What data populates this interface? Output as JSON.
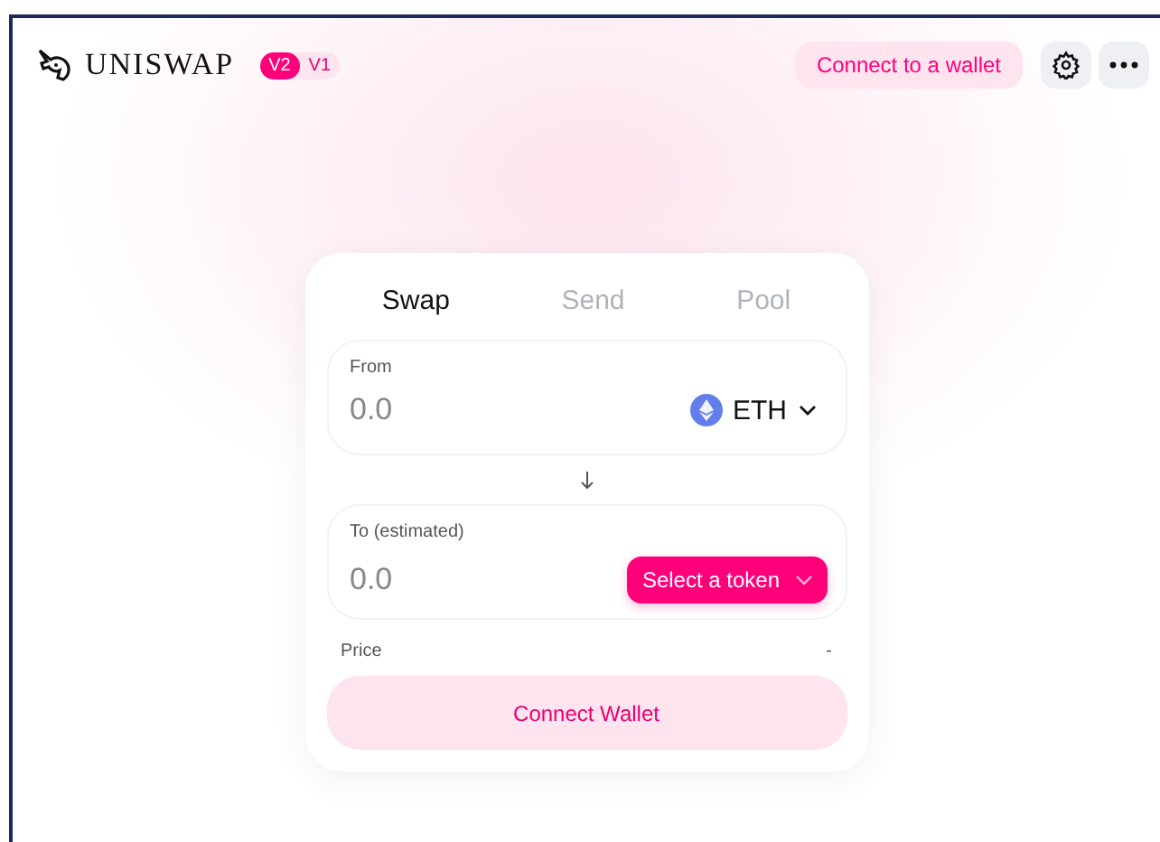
{
  "header": {
    "logo": "UNISWAP",
    "versions": [
      {
        "label": "V2",
        "selected": true
      },
      {
        "label": "V1",
        "selected": false
      }
    ],
    "connect_button": "Connect to a wallet"
  },
  "tabs": [
    {
      "label": "Swap",
      "selected": true
    },
    {
      "label": "Send",
      "selected": false
    },
    {
      "label": "Pool",
      "selected": false
    }
  ],
  "from": {
    "label": "From",
    "placeholder": "0.0",
    "token": "ETH"
  },
  "to": {
    "label": "To (estimated)",
    "placeholder": "0.0",
    "token_button": "Select a token"
  },
  "price": {
    "label": "Price",
    "value": "-"
  },
  "action_button": "Connect Wallet"
}
